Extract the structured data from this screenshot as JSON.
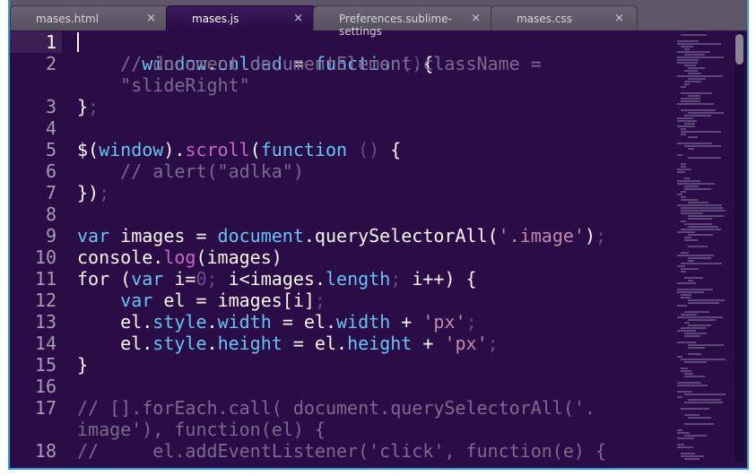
{
  "tabs": [
    {
      "label": "mases.html",
      "active": false
    },
    {
      "label": "mases.js",
      "active": true
    },
    {
      "label": "Preferences.sublime-settings",
      "active": false
    },
    {
      "label": "mases.css",
      "active": false
    }
  ],
  "close_glyph": "×",
  "line_numbers": [
    "1",
    "2",
    "",
    "3",
    "4",
    "5",
    "6",
    "7",
    "8",
    "9",
    "10",
    "11",
    "12",
    "13",
    "14",
    "15",
    "16",
    "17",
    "",
    "18"
  ],
  "code": {
    "l1": {
      "a": "window",
      "b": ".",
      "c": "onload",
      "d": " = ",
      "e": "function",
      "f": "()",
      "g": "{"
    },
    "l2a": "    // document.documentElement.className =",
    "l2b": "    \"slideRight\"",
    "l3": {
      "a": "}",
      "b": ";"
    },
    "l5": {
      "a": "$(",
      "b": "window",
      "c": ").",
      "d": "scroll",
      "e": "(",
      "f": "function",
      "g": " () ",
      "h": "{"
    },
    "l6": "    // alert(\"adlka\")",
    "l7": {
      "a": "})",
      "b": ";"
    },
    "l9": {
      "a": "var",
      "b": " images = ",
      "c": "document",
      "d": ".",
      "e": "querySelectorAll",
      "f": "(",
      "g": "'.image'",
      "h": ")",
      "i": ";"
    },
    "l10": {
      "a": "console",
      "b": ".",
      "c": "log",
      "d": "(images)"
    },
    "l11": {
      "a": "for",
      "b": " (",
      "c": "var",
      "d": " i=",
      "e": "0",
      "f": "; ",
      "g": "i<images",
      "h": ".",
      "i": "length",
      "j": "; ",
      "k": "i++) {"
    },
    "l12": {
      "a": "    ",
      "b": "var",
      "c": " el = images[i]",
      "d": ";"
    },
    "l13": {
      "a": "    el",
      "b": ".",
      "c": "style",
      "d": ".",
      "e": "width",
      "f": " = el",
      "g": ".",
      "h": "width",
      "i": " + ",
      "j": "'px'",
      "k": ";"
    },
    "l14": {
      "a": "    el",
      "b": ".",
      "c": "style",
      "d": ".",
      "e": "height",
      "f": " = el",
      "g": ".",
      "h": "height",
      "i": " + ",
      "j": "'px'",
      "k": ";"
    },
    "l15": "}",
    "l17a": "// [].forEach.call( document.querySelectorAll('.",
    "l17b": "image'), function(el) {",
    "l18": "//     el.addEventListener('click', function(e) {"
  },
  "colors": {
    "background": "#2a0c47",
    "keyword": "#66c4f0",
    "comment": "#7a6a8c",
    "string": "#e8a0c6",
    "window_border": "#2f9adf"
  }
}
